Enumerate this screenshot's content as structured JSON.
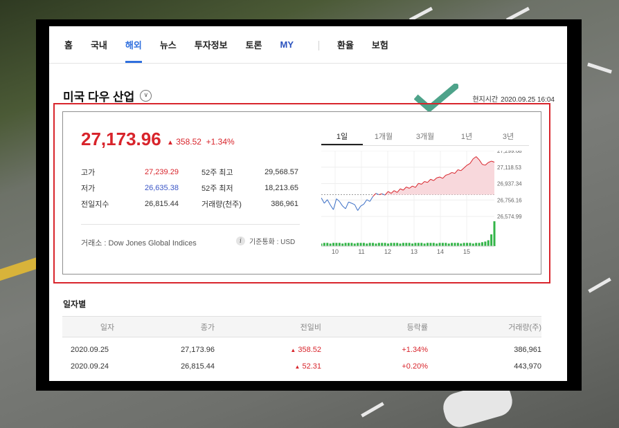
{
  "nav": {
    "items": [
      "홈",
      "국내",
      "해외",
      "뉴스",
      "투자정보",
      "토론",
      "MY",
      "환율",
      "보험"
    ],
    "active": "해외"
  },
  "index": {
    "title": "미국 다우 산업",
    "local_time_label": "현지시간",
    "local_time": "2020.09.25 16:04",
    "price": "27,173.96",
    "change": "358.52",
    "change_pct": "+1.34%",
    "up_color": "#d8242b",
    "down_color": "#3a55c6"
  },
  "stats": {
    "high_label": "고가",
    "high": "27,239.29",
    "low_label": "저가",
    "low": "26,635.38",
    "prev_label": "전일지수",
    "prev": "26,815.44",
    "w52_high_label": "52주 최고",
    "w52_high": "29,568.57",
    "w52_low_label": "52주 최저",
    "w52_low": "18,213.65",
    "volume_label": "거래량(천주)",
    "volume": "386,961"
  },
  "footer": {
    "exchange": "거래소 : Dow Jones Global Indices",
    "currency": "기준통화 : USD"
  },
  "chart_tabs": [
    "1일",
    "1개월",
    "3개월",
    "1년",
    "3년"
  ],
  "chart_data": {
    "type": "line",
    "title": "",
    "x_ticks": [
      "10",
      "11",
      "12",
      "13",
      "14",
      "15"
    ],
    "y_ticks": [
      "27,299.68",
      "27,118.53",
      "26,937.34",
      "26,756.16",
      "26,574.99"
    ],
    "ylim": [
      26574.99,
      27299.68
    ],
    "baseline": 26815.44,
    "series": [
      {
        "values": [
          26780,
          26720,
          26760,
          26700,
          26650,
          26770,
          26740,
          26690,
          26660,
          26735,
          26720,
          26705,
          26640,
          26690,
          26710,
          26760,
          26740,
          26795,
          26830,
          26815,
          26825,
          26810,
          26850,
          26830,
          26860,
          26840,
          26880,
          26865,
          26900,
          26885,
          26910,
          26895,
          26940,
          26930,
          26960,
          26950,
          26985,
          26970,
          27000,
          27010,
          26995,
          27030,
          27040,
          27060,
          27050,
          27090,
          27080,
          27110,
          27140,
          27160,
          27210,
          27235,
          27200,
          27150,
          27140,
          27170,
          27185,
          27173.96
        ]
      }
    ],
    "volume": [
      4,
      5,
      5,
      4,
      5,
      5,
      5,
      4,
      5,
      5,
      5,
      4,
      5,
      5,
      5,
      4,
      5,
      5,
      4,
      5,
      5,
      5,
      4,
      5,
      5,
      5,
      4,
      5,
      5,
      5,
      4,
      5,
      5,
      5,
      4,
      5,
      5,
      5,
      4,
      5,
      5,
      5,
      4,
      5,
      5,
      5,
      4,
      5,
      5,
      5,
      4,
      5,
      5,
      6,
      7,
      9,
      18,
      38
    ],
    "grid": true,
    "up_color": "#d8242b",
    "down_color": "#3a6ec6",
    "volume_color": "#33b548"
  },
  "daily": {
    "title": "일자별",
    "headers": [
      "일자",
      "종가",
      "전일비",
      "등락률",
      "거래량(주)"
    ],
    "rows": [
      {
        "date": "2020.09.25",
        "close": "27,173.96",
        "diff": "358.52",
        "rate": "+1.34%",
        "volume": "386,961"
      },
      {
        "date": "2020.09.24",
        "close": "26,815.44",
        "diff": "52.31",
        "rate": "+0.20%",
        "volume": "443,970"
      }
    ]
  }
}
